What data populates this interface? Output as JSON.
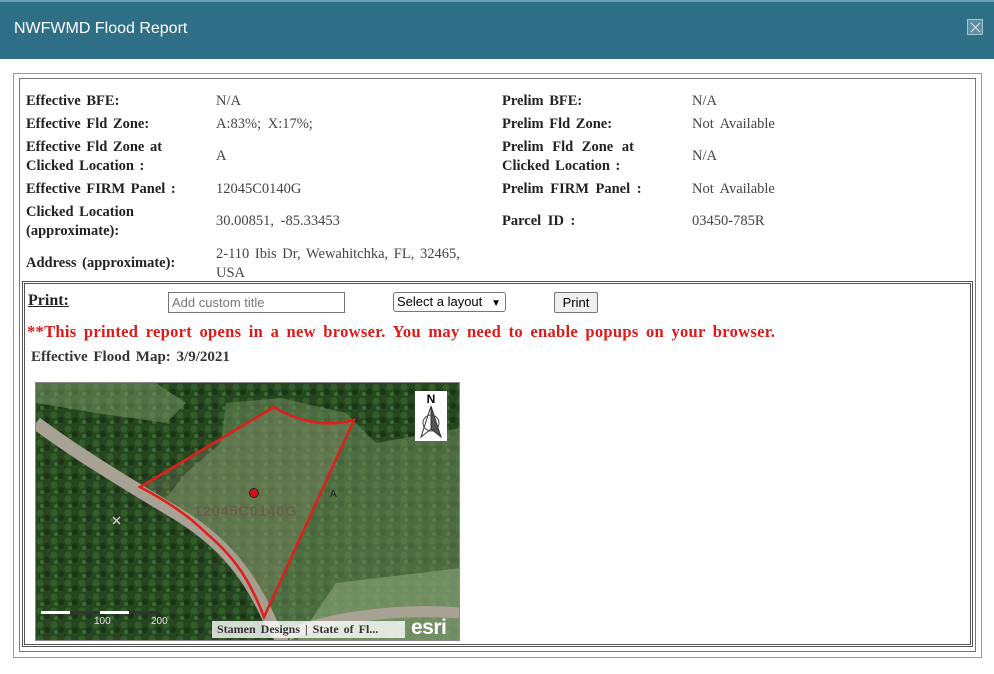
{
  "window": {
    "title": "NWFWMD Flood Report",
    "close_icon": "close-icon"
  },
  "info": {
    "effective_bfe_label": "Effective BFE:",
    "effective_bfe_value": "N/A",
    "effective_fld_zone_label": "Effective Fld Zone:",
    "effective_fld_zone_value": "A:83%; X:17%;",
    "effective_fld_zone_at_label_1": "Effective Fld Zone at",
    "effective_fld_zone_at_label_2": "Clicked Location :",
    "effective_fld_zone_at_value": "A",
    "effective_firm_panel_label": "Effective FIRM Panel :",
    "effective_firm_panel_value": "12045C0140G",
    "clicked_location_label_1": "Clicked Location",
    "clicked_location_label_2": "(approximate):",
    "clicked_location_value": "30.00851, -85.33453",
    "address_label": "Address (approximate):",
    "address_value_1": "2-110 Ibis Dr, Wewahitchka, FL, 32465,",
    "address_value_2": "USA",
    "prelim_bfe_label": "Prelim BFE:",
    "prelim_bfe_value": "N/A",
    "prelim_fld_zone_label": "Prelim Fld Zone:",
    "prelim_fld_zone_value": "Not Available",
    "prelim_fld_zone_at_label_1": "Prelim Fld Zone at",
    "prelim_fld_zone_at_label_2": "Clicked Location :",
    "prelim_fld_zone_at_value": "N/A",
    "prelim_firm_panel_label": "Prelim FIRM Panel :",
    "prelim_firm_panel_value": "Not Available",
    "parcel_id_label": "Parcel ID :",
    "parcel_id_value": "03450-785R"
  },
  "print": {
    "label": "Print:",
    "title_placeholder": "Add custom title",
    "title_value": "",
    "layout_selected": "Select a layout",
    "button_label": "Print",
    "warning": "**This printed report opens in a new browser. You may need to enable popups on your browser."
  },
  "map": {
    "title": "Effective Flood Map: 3/9/2021",
    "north_label": "N",
    "panel_label": "12045C0140G",
    "zone_label": "A",
    "scale_label_1": "100",
    "scale_label_2": "200",
    "attribution": "Stamen Designs | State of Fl...",
    "logo_text": "esri",
    "colors": {
      "boundary": "#e31c1c",
      "marker": "#d11414"
    }
  }
}
